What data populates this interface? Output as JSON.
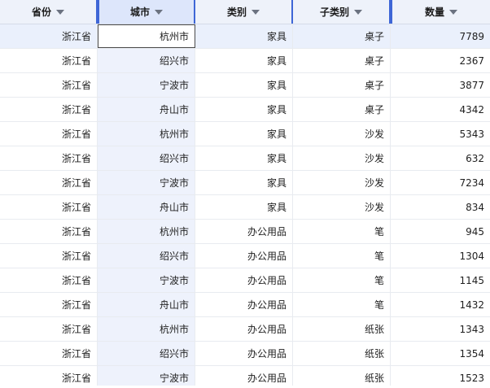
{
  "columns": [
    {
      "label": "省份"
    },
    {
      "label": "城市"
    },
    {
      "label": "类别"
    },
    {
      "label": "子类别"
    },
    {
      "label": "数量"
    }
  ],
  "rows": [
    [
      "浙江省",
      "杭州市",
      "家具",
      "桌子",
      "7789"
    ],
    [
      "浙江省",
      "绍兴市",
      "家具",
      "桌子",
      "2367"
    ],
    [
      "浙江省",
      "宁波市",
      "家具",
      "桌子",
      "3877"
    ],
    [
      "浙江省",
      "舟山市",
      "家具",
      "桌子",
      "4342"
    ],
    [
      "浙江省",
      "杭州市",
      "家具",
      "沙发",
      "5343"
    ],
    [
      "浙江省",
      "绍兴市",
      "家具",
      "沙发",
      "632"
    ],
    [
      "浙江省",
      "宁波市",
      "家具",
      "沙发",
      "7234"
    ],
    [
      "浙江省",
      "舟山市",
      "家具",
      "沙发",
      "834"
    ],
    [
      "浙江省",
      "杭州市",
      "办公用品",
      "笔",
      "945"
    ],
    [
      "浙江省",
      "绍兴市",
      "办公用品",
      "笔",
      "1304"
    ],
    [
      "浙江省",
      "宁波市",
      "办公用品",
      "笔",
      "1145"
    ],
    [
      "浙江省",
      "舟山市",
      "办公用品",
      "笔",
      "1432"
    ],
    [
      "浙江省",
      "杭州市",
      "办公用品",
      "纸张",
      "1343"
    ],
    [
      "浙江省",
      "绍兴市",
      "办公用品",
      "纸张",
      "1354"
    ],
    [
      "浙江省",
      "宁波市",
      "办公用品",
      "纸张",
      "1523"
    ]
  ],
  "icons": {
    "sort": "caret-down-icon"
  },
  "colors": {
    "header_bg": "#eef2fa",
    "accent": "#3e66d6",
    "selected_column_bg": "#eef2fc"
  }
}
